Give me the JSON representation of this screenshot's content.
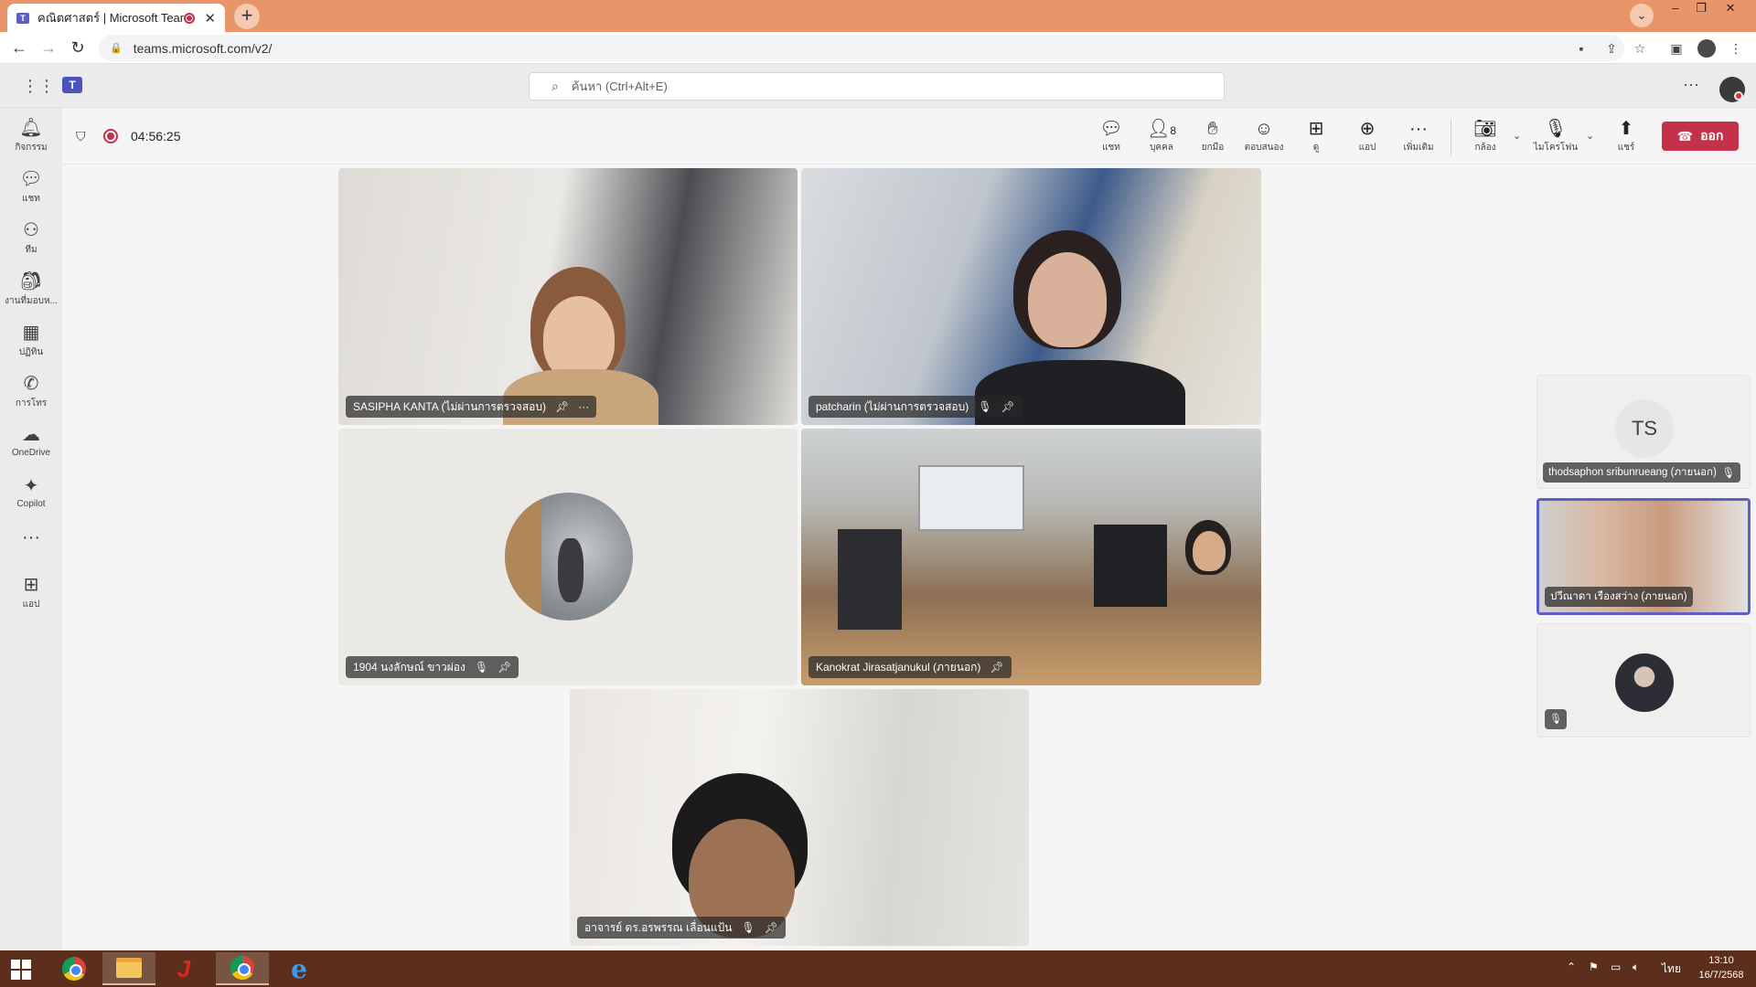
{
  "browser": {
    "tab_title": "คณิตศาสตร์ | Microsoft Teams",
    "url": "teams.microsoft.com/v2/"
  },
  "teams": {
    "search_placeholder": "ค้นหา (Ctrl+Alt+E)",
    "more": "···"
  },
  "rail": [
    {
      "label": "กิจกรรม",
      "icon": "bell-icon"
    },
    {
      "label": "แชท",
      "icon": "chat-icon"
    },
    {
      "label": "ทีม",
      "icon": "teams-icon"
    },
    {
      "label": "งานที่มอบห...",
      "icon": "assignments-icon"
    },
    {
      "label": "ปฏิทิน",
      "icon": "calendar-icon"
    },
    {
      "label": "การโทร",
      "icon": "phone-icon"
    },
    {
      "label": "OneDrive",
      "icon": "cloud-icon"
    },
    {
      "label": "Copilot",
      "icon": "copilot-icon"
    },
    {
      "label": "",
      "icon": "more-icon"
    },
    {
      "label": "แอป",
      "icon": "apps-icon"
    }
  ],
  "meeting": {
    "timer": "04:56:25",
    "controls": {
      "chat": "แชท",
      "people": "บุคคล",
      "people_count": "8",
      "raise": "ยกมือ",
      "react": "ตอบสนอง",
      "view": "ดู",
      "apps": "แอป",
      "more": "เพิ่มเติม",
      "camera": "กล้อง",
      "mic": "ไมโครโฟน",
      "share": "แชร์",
      "leave": "ออก"
    },
    "tiles": [
      {
        "name": "SASIPHA KANTA (ไม่ผ่านการตรวจสอบ)"
      },
      {
        "name": "patcharin (ไม่ผ่านการตรวจสอบ)"
      },
      {
        "name": "1904 นงลักษณ์ ขาวผ่อง"
      },
      {
        "name": "Kanokrat Jirasatjanukul (ภายนอก)"
      },
      {
        "name": "อาจารย์ ดร.อรพรรณ เลื่อนแป้น"
      }
    ],
    "side": [
      {
        "initials": "TS",
        "name": "thodsaphon sribunrueang (ภายนอก)"
      },
      {
        "name": "ปวีณาดา เรืองสว่าง (ภายนอก)"
      }
    ]
  },
  "taskbar": {
    "lang": "ไทย",
    "time": "13:10",
    "date": "16/7/2568"
  },
  "colors": {
    "tabbar": "#e8956a",
    "leave": "#c4314b",
    "accent": "#5b5fc7",
    "taskbar": "#5b2f1c"
  }
}
